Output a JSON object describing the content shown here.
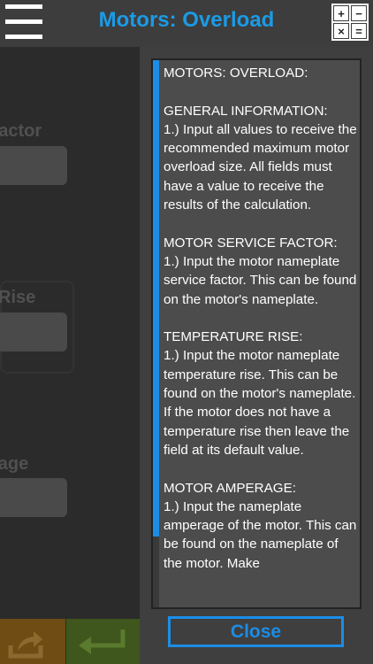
{
  "header": {
    "title": "Motors: Overload",
    "calc_keys": [
      "+",
      "−",
      "×",
      "="
    ]
  },
  "form": {
    "labels": [
      "Factor",
      "Rise",
      "rage"
    ]
  },
  "help": {
    "sections": [
      {
        "heading": "MOTORS: OVERLOAD:",
        "body": ""
      },
      {
        "heading": "GENERAL INFORMATION:",
        "body": "1.) Input all values to receive the recommended maximum motor overload size. All fields must have a value to receive the results of the calculation."
      },
      {
        "heading": "MOTOR SERVICE FACTOR:",
        "body": "1.) Input the motor nameplate service factor. This can be found on the motor's nameplate."
      },
      {
        "heading": "TEMPERATURE RISE:",
        "body": "1.) Input the motor nameplate temperature rise. This can be found on the motor's nameplate. If the motor does not have a temperature rise then leave the field at its default value."
      },
      {
        "heading": "MOTOR AMPERAGE:",
        "body": "1.) Input the nameplate amperage of the motor. This can be found on the nameplate of the motor. Make"
      }
    ],
    "close_label": "Close"
  },
  "colors": {
    "accent": "#1b9be6",
    "export_button": "#6e4c14",
    "enter_button": "#3f561c"
  },
  "icons": [
    "hamburger-menu-icon",
    "calculator-icon",
    "export-icon",
    "enter-return-icon"
  ]
}
